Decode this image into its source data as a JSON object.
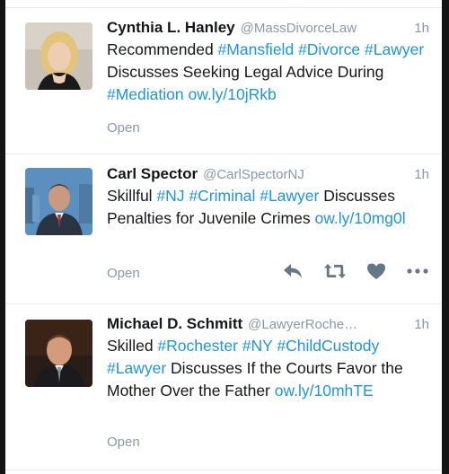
{
  "tweets": [
    {
      "fullname": "Cynthia L. Hanley",
      "handle": "@MassDivorceLaw",
      "time": "1h",
      "segments": [
        {
          "text": "Recommended ",
          "link": false
        },
        {
          "text": "#Mansfield",
          "link": true
        },
        {
          "text": " ",
          "link": false
        },
        {
          "text": "#Divorce",
          "link": true
        },
        {
          "text": " ",
          "link": false
        },
        {
          "text": "#Lawyer",
          "link": true
        },
        {
          "text": " Discusses Seeking Legal Advice During ",
          "link": false
        },
        {
          "text": "#Mediation",
          "link": true
        },
        {
          "text": " ",
          "link": false
        },
        {
          "text": "ow.ly/10jRkb",
          "link": true
        }
      ],
      "open_label": "Open"
    },
    {
      "fullname": "Carl Spector",
      "handle": "@CarlSpectorNJ",
      "time": "1h",
      "segments": [
        {
          "text": "Skillful ",
          "link": false
        },
        {
          "text": "#NJ",
          "link": true
        },
        {
          "text": " ",
          "link": false
        },
        {
          "text": "#Criminal",
          "link": true
        },
        {
          "text": " ",
          "link": false
        },
        {
          "text": "#Lawyer",
          "link": true
        },
        {
          "text": " Discusses Penalties for Juvenile Crimes ",
          "link": false
        },
        {
          "text": "ow.ly/10mg0l",
          "link": true
        }
      ],
      "open_label": "Open",
      "actions": [
        "reply-icon",
        "retweet-icon",
        "like-icon",
        "more-icon"
      ]
    },
    {
      "fullname": "Michael D. Schmitt",
      "handle": "@LawyerRoche…",
      "time": "1h",
      "segments": [
        {
          "text": "Skilled ",
          "link": false
        },
        {
          "text": "#Rochester",
          "link": true
        },
        {
          "text": " ",
          "link": false
        },
        {
          "text": "#NY",
          "link": true
        },
        {
          "text": " ",
          "link": false
        },
        {
          "text": "#ChildCustody",
          "link": true
        },
        {
          "text": " ",
          "link": false
        },
        {
          "text": "#Lawyer",
          "link": true
        },
        {
          "text": " Discusses If the Courts Favor the Mother Over the Father ",
          "link": false
        },
        {
          "text": "ow.ly/10mhTE",
          "link": true
        }
      ],
      "open_label": "Open"
    }
  ],
  "colors": {
    "link": "#1b95e0",
    "secondary_text": "#8899a6",
    "primary_text": "#14171a",
    "action_icon": "#657786"
  }
}
